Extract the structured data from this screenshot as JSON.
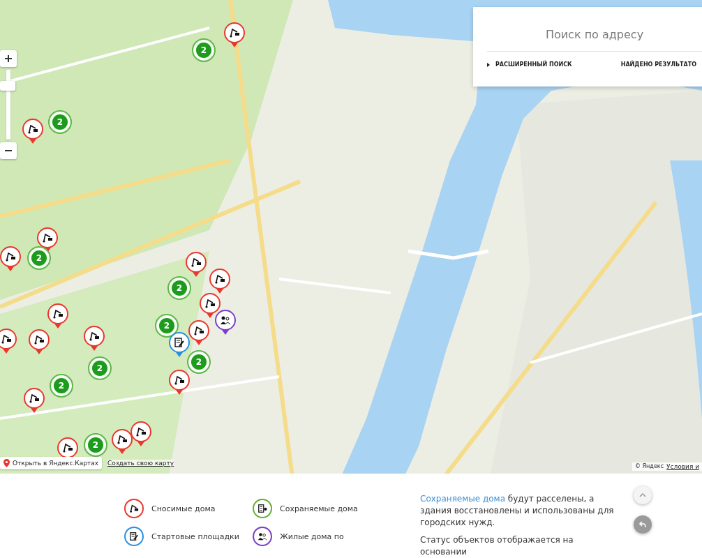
{
  "map": {
    "markers": [
      {
        "kind": "demolish"
      },
      {
        "kind": "cluster",
        "count": "2"
      },
      {
        "kind": "cluster",
        "count": "2"
      },
      {
        "kind": "demolish"
      },
      {
        "kind": "demolish"
      },
      {
        "kind": "demolish"
      },
      {
        "kind": "cluster",
        "count": "2"
      },
      {
        "kind": "demolish"
      },
      {
        "kind": "demolish"
      },
      {
        "kind": "cluster",
        "count": "2"
      },
      {
        "kind": "demolish"
      },
      {
        "kind": "demolish"
      },
      {
        "kind": "residential"
      },
      {
        "kind": "cluster",
        "count": "2"
      },
      {
        "kind": "demolish"
      },
      {
        "kind": "demolish"
      },
      {
        "kind": "demolish"
      },
      {
        "kind": "demolish"
      },
      {
        "kind": "start"
      },
      {
        "kind": "cluster",
        "count": "2"
      },
      {
        "kind": "cluster",
        "count": "2"
      },
      {
        "kind": "demolish"
      },
      {
        "kind": "cluster",
        "count": "2"
      },
      {
        "kind": "demolish"
      },
      {
        "kind": "demolish"
      },
      {
        "kind": "demolish"
      },
      {
        "kind": "cluster",
        "count": "2"
      },
      {
        "kind": "demolish"
      }
    ]
  },
  "search": {
    "title": "Поиск по адресу",
    "advanced": "РАСШИРЕННЫЙ ПОИСК",
    "results": "НАЙДЕНО РЕЗУЛЬТАТО"
  },
  "map_footer": {
    "open_button": "Открыть в Яндекс.Картах",
    "create_link": "Создать свою карту",
    "copyright": "© Яндекс",
    "terms_link": "Условия и"
  },
  "legend": [
    {
      "kind": "demolish",
      "label": "Сносимые дома"
    },
    {
      "kind": "preserve",
      "label": "Сохраняемые дома"
    },
    {
      "kind": "start",
      "label": "Стартовые площадки"
    },
    {
      "kind": "residential",
      "label": "Жилые дома по"
    }
  ],
  "note": {
    "link": "Сохраняемые дома",
    "text": "будут расселены, а здания восстановлены и использованы для городских нужд.",
    "next": "Статус объектов отображается на основании"
  }
}
